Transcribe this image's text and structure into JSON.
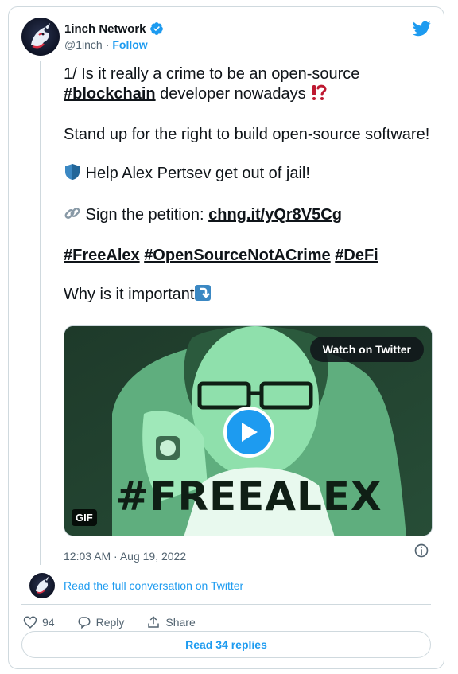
{
  "author": {
    "name": "1inch Network",
    "handle": "@1inch",
    "separator": "·",
    "follow_label": "Follow"
  },
  "tweet": {
    "line1_text": "1/ Is it really a crime to be an open-source ",
    "line1_hashtag": "#blockchain",
    "line1_rest": " developer nowadays ",
    "line1_emoji": "⁉️",
    "para2": "Stand up for the right to build open-source software!",
    "para3_emoji": "🛡️",
    "para3_text": " Help Alex Pertsev get out of jail!",
    "para4_emoji": "🔗",
    "para4_text": " Sign the petition: ",
    "para4_link": "chng.it/yQr8V5Cg",
    "hashtags": [
      "#FreeAlex",
      "#OpenSourceNotACrime",
      "#DeFi"
    ],
    "para6_text": "Why is it important",
    "para6_emoji": "⤵️"
  },
  "media": {
    "watch_label": "Watch on Twitter",
    "gif_label": "GIF",
    "image_text": "#FREEALEX"
  },
  "meta": {
    "timestamp": "12:03 AM · Aug 19, 2022"
  },
  "conversation": {
    "read_label": "Read the full conversation on Twitter"
  },
  "actions": {
    "like_count": "94",
    "reply_label": "Reply",
    "share_label": "Share"
  },
  "footer": {
    "read_replies_label": "Read 34 replies"
  },
  "colors": {
    "accent": "#1d9bf0",
    "text": "#0f1419",
    "muted": "#536471",
    "border": "#cfd9de",
    "media_green": "#7fd6a0"
  }
}
